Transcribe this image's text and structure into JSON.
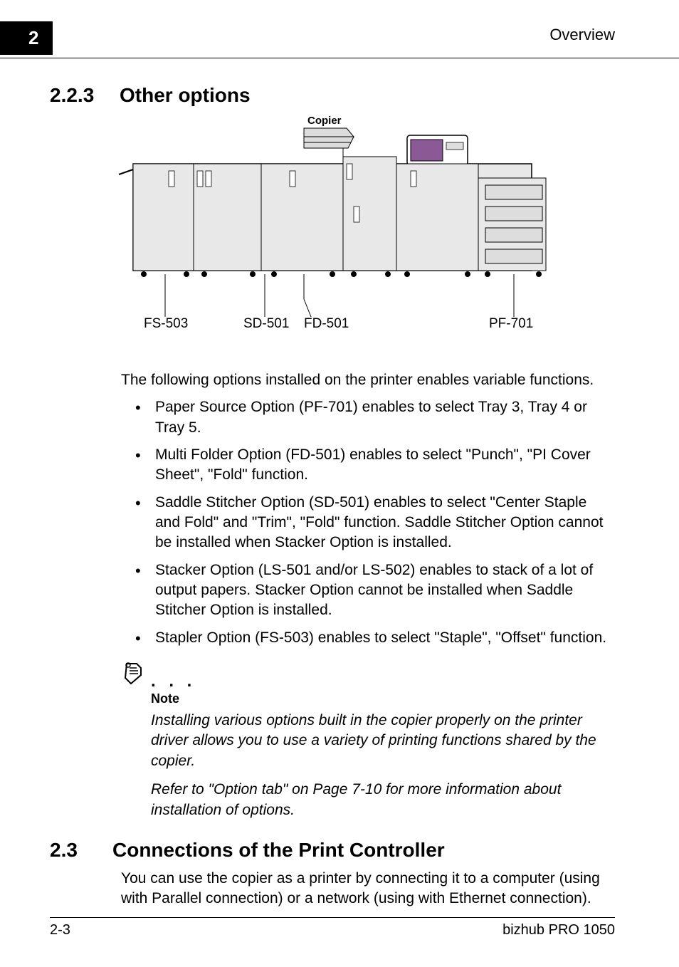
{
  "header": {
    "chapter_number": "2",
    "right_title": "Overview"
  },
  "section223": {
    "number": "2.2.3",
    "title": "Other options"
  },
  "diagram": {
    "copier_label": "Copier",
    "labels": [
      "FS-503",
      "SD-501",
      "FD-501",
      "PF-701"
    ]
  },
  "intro_text": "The following options installed on the printer enables variable functions.",
  "bullets": [
    "Paper Source Option (PF-701) enables to select Tray 3, Tray 4 or Tray 5.",
    "Multi Folder Option (FD-501) enables to select \"Punch\", \"PI Cover Sheet\", \"Fold\" function.",
    "Saddle Stitcher Option (SD-501) enables to select \"Center Staple and Fold\" and \"Trim\", \"Fold\" function. Saddle Stitcher Option cannot be installed when Stacker Option is installed.",
    "Stacker Option (LS-501 and/or LS-502) enables to stack of a lot of output papers. Stacker Option cannot be installed when Saddle Stitcher Option is installed.",
    "Stapler Option (FS-503) enables to select \"Staple\", \"Offset\" function."
  ],
  "note": {
    "label": "Note",
    "para1": "Installing various options built in the copier properly on the printer driver allows you to use a variety of printing functions shared by the copier.",
    "para2": "Refer to \"Option tab\" on Page 7-10 for more information about installation of options."
  },
  "section23": {
    "number": "2.3",
    "title": "Connections of the Print Controller",
    "text": "You can use the copier as a printer by connecting it to a computer (using with Parallel connection) or a network (using with Ethernet connection)."
  },
  "footer": {
    "page": "2-3",
    "product": "bizhub PRO 1050"
  }
}
